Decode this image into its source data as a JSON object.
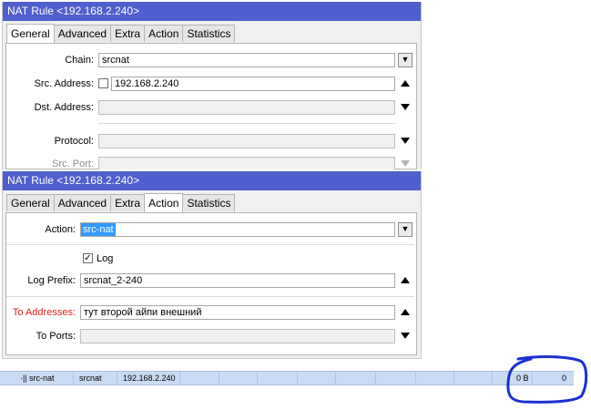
{
  "window1": {
    "title": "NAT Rule <192.168.2.240>",
    "tabs": [
      "General",
      "Advanced",
      "Extra",
      "Action",
      "Statistics"
    ],
    "chain_label": "Chain:",
    "chain_value": "srcnat",
    "src_address_label": "Src. Address:",
    "src_address_value": "192.168.2.240",
    "dst_address_label": "Dst. Address:",
    "protocol_label": "Protocol:",
    "src_port_label": "Src. Port:"
  },
  "window2": {
    "title": "NAT Rule <192.168.2.240>",
    "tabs": [
      "General",
      "Advanced",
      "Extra",
      "Action",
      "Statistics"
    ],
    "action_label": "Action:",
    "action_value": "src-nat",
    "log_label": "Log",
    "log_checked": true,
    "log_prefix_label": "Log Prefix:",
    "log_prefix_value": "srcnat_2-240",
    "to_addresses_label": "To Addresses:",
    "to_addresses_value": "тут второй айпи внешний",
    "to_ports_label": "To Ports:"
  },
  "list_row": {
    "marker": "·||",
    "action": "src-nat",
    "chain": "srcnat",
    "src_address": "192.168.2.240",
    "bytes": "0 B",
    "packets": "0"
  },
  "colors": {
    "titlebar": "#4f5fce",
    "selection": "#3399ff",
    "red_label": "#e0201c",
    "row_highlight": "#c9dbf3",
    "annotation": "#1b2fd1"
  }
}
